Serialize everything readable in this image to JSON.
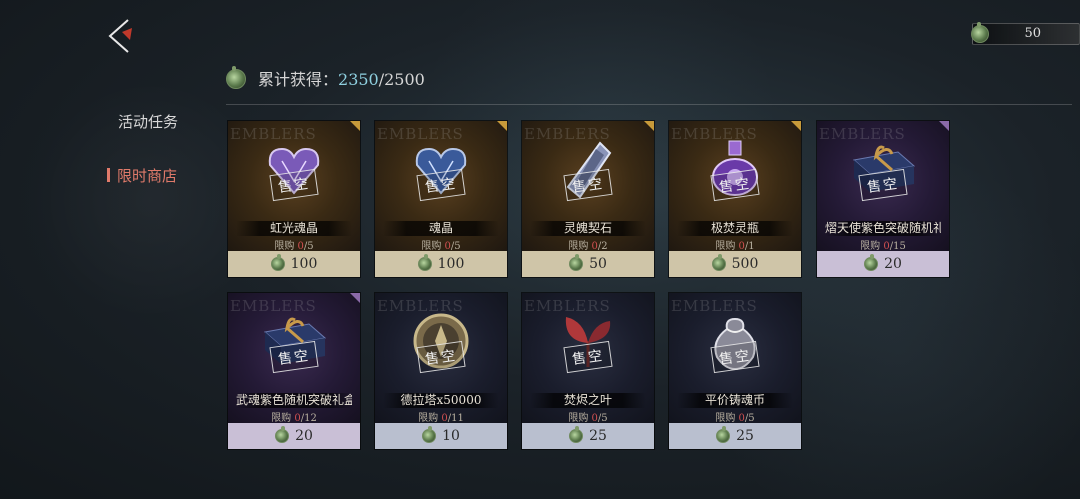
{
  "header": {
    "currency_value": "50",
    "progress_label": "累计获得：",
    "progress_current": "2350",
    "progress_total": "/2500"
  },
  "nav": {
    "items": [
      {
        "label": "活动任务",
        "active": false
      },
      {
        "label": "限时商店",
        "active": true
      }
    ]
  },
  "shop": {
    "watermark": "EMBLERS",
    "limit_label": "限购",
    "sold_out_label": "售空",
    "items": [
      {
        "name": "虹光魂晶",
        "bought": "0",
        "limit": "/5",
        "price": "100",
        "rarity": "gold",
        "icon": "rainbow-soul-crystal-icon"
      },
      {
        "name": "魂晶",
        "bought": "0",
        "limit": "/5",
        "price": "100",
        "rarity": "gold",
        "icon": "soul-crystal-icon"
      },
      {
        "name": "灵魄契石",
        "bought": "0",
        "limit": "/2",
        "price": "50",
        "rarity": "gold",
        "icon": "spirit-contract-stone-icon"
      },
      {
        "name": "极焚灵瓶",
        "bought": "0",
        "limit": "/1",
        "price": "500",
        "rarity": "gold",
        "icon": "spirit-flask-icon"
      },
      {
        "name": "熠天使紫色突破随机礼盒",
        "bought": "0",
        "limit": "/15",
        "price": "20",
        "rarity": "purple",
        "icon": "gift-box-icon"
      },
      {
        "name": "武魂紫色随机突破礼盒",
        "bought": "0",
        "limit": "/12",
        "price": "20",
        "rarity": "purple",
        "icon": "gift-box-icon"
      },
      {
        "name": "德拉塔x50000",
        "bought": "0",
        "limit": "/11",
        "price": "10",
        "rarity": "blue",
        "icon": "coin-icon"
      },
      {
        "name": "焚烬之叶",
        "bought": "0",
        "limit": "/5",
        "price": "25",
        "rarity": "blue",
        "icon": "leaf-icon"
      },
      {
        "name": "平价铸魂币",
        "bought": "0",
        "limit": "/5",
        "price": "25",
        "rarity": "blue",
        "icon": "soul-coin-pouch-icon"
      }
    ]
  }
}
